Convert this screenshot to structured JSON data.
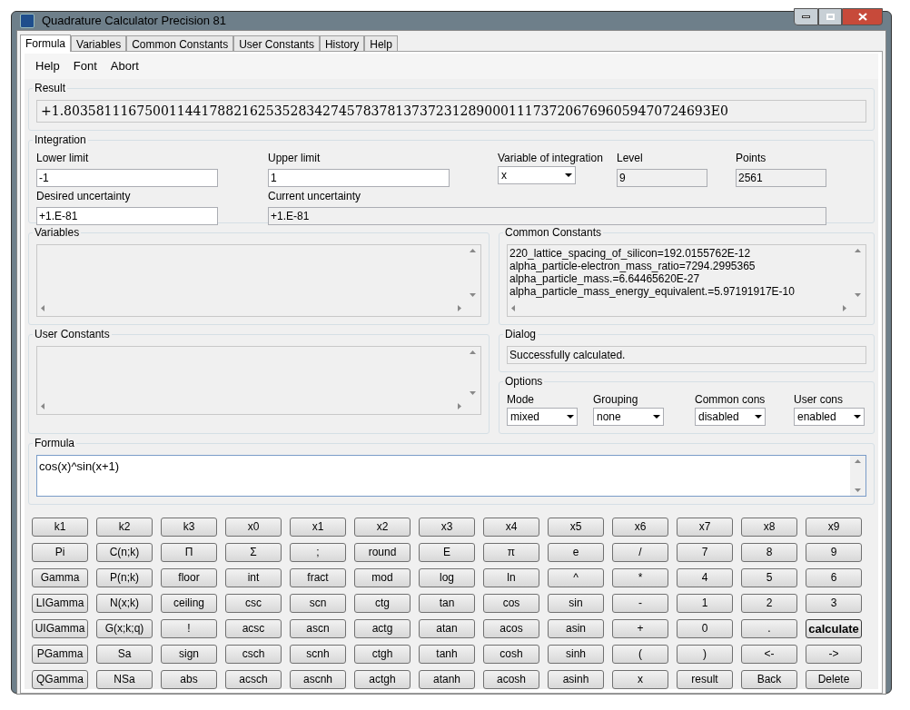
{
  "window": {
    "title": "Quadrature Calculator Precision 81"
  },
  "tabs": [
    {
      "label": "Formula",
      "selected": true
    },
    {
      "label": "Variables",
      "selected": false
    },
    {
      "label": "Common Constants",
      "selected": false
    },
    {
      "label": "User Constants",
      "selected": false
    },
    {
      "label": "History",
      "selected": false
    },
    {
      "label": "Help",
      "selected": false
    }
  ],
  "menu": [
    "Help",
    "Font",
    "Abort"
  ],
  "result": {
    "label": "Result",
    "value": "+1.80358111675001144178821625352834274578378137372312890001117372067696059470724693E0"
  },
  "integration": {
    "label": "Integration",
    "lower_limit": {
      "label": "Lower limit",
      "value": "-1"
    },
    "upper_limit": {
      "label": "Upper limit",
      "value": "1"
    },
    "variable": {
      "label": "Variable of integration",
      "value": "x"
    },
    "level": {
      "label": "Level",
      "value": "9"
    },
    "points": {
      "label": "Points",
      "value": "2561"
    },
    "desired_uncertainty": {
      "label": "Desired uncertainty",
      "value": "+1.E-81"
    },
    "current_uncertainty": {
      "label": "Current uncertainty",
      "value": "+1.E-81"
    }
  },
  "variables": {
    "label": "Variables"
  },
  "common_constants": {
    "label": "Common Constants",
    "items": [
      "220_lattice_spacing_of_silicon=192.0155762E-12",
      "alpha_particle-electron_mass_ratio=7294.2995365",
      "alpha_particle_mass.=6.64465620E-27",
      "alpha_particle_mass_energy_equivalent.=5.97191917E-10"
    ]
  },
  "user_constants": {
    "label": "User Constants"
  },
  "dialog": {
    "label": "Dialog",
    "message": "Successfully calculated."
  },
  "options": {
    "label": "Options",
    "fields": [
      {
        "label": "Mode",
        "value": "mixed"
      },
      {
        "label": "Grouping",
        "value": "none"
      },
      {
        "label": "Common cons",
        "value": "disabled"
      },
      {
        "label": "User cons",
        "value": "enabled"
      }
    ]
  },
  "formula": {
    "label": "Formula",
    "value": "cos(x)^sin(x+1)"
  },
  "keypad": {
    "rows": [
      [
        {
          "label": "k1",
          "default": false
        },
        {
          "label": "k2",
          "default": false
        },
        {
          "label": "k3",
          "default": false
        },
        {
          "label": "x0",
          "default": false
        },
        {
          "label": "x1",
          "default": false
        },
        {
          "label": "x2",
          "default": false
        },
        {
          "label": "x3",
          "default": false
        },
        {
          "label": "x4",
          "default": false
        },
        {
          "label": "x5",
          "default": false
        },
        {
          "label": "x6",
          "default": false
        },
        {
          "label": "x7",
          "default": false
        },
        {
          "label": "x8",
          "default": false
        },
        {
          "label": "x9",
          "default": false
        }
      ],
      [
        {
          "label": "Pi",
          "default": false
        },
        {
          "label": "C(n;k)",
          "default": false
        },
        {
          "label": "Π",
          "default": false
        },
        {
          "label": "Σ",
          "default": false
        },
        {
          "label": ";",
          "default": false
        },
        {
          "label": "round",
          "default": false
        },
        {
          "label": "E",
          "default": false
        },
        {
          "label": "π",
          "default": false
        },
        {
          "label": "e",
          "default": false
        },
        {
          "label": "/",
          "default": false
        },
        {
          "label": "7",
          "default": false
        },
        {
          "label": "8",
          "default": false
        },
        {
          "label": "9",
          "default": false
        }
      ],
      [
        {
          "label": "Gamma",
          "default": false
        },
        {
          "label": "P(n;k)",
          "default": false
        },
        {
          "label": "floor",
          "default": false
        },
        {
          "label": "int",
          "default": false
        },
        {
          "label": "fract",
          "default": false
        },
        {
          "label": "mod",
          "default": false
        },
        {
          "label": "log",
          "default": false
        },
        {
          "label": "ln",
          "default": false
        },
        {
          "label": "^",
          "default": false
        },
        {
          "label": "*",
          "default": false
        },
        {
          "label": "4",
          "default": false
        },
        {
          "label": "5",
          "default": false
        },
        {
          "label": "6",
          "default": false
        }
      ],
      [
        {
          "label": "LIGamma",
          "default": false
        },
        {
          "label": "N(x;k)",
          "default": false
        },
        {
          "label": "ceiling",
          "default": false
        },
        {
          "label": "csc",
          "default": false
        },
        {
          "label": "scn",
          "default": false
        },
        {
          "label": "ctg",
          "default": false
        },
        {
          "label": "tan",
          "default": false
        },
        {
          "label": "cos",
          "default": false
        },
        {
          "label": "sin",
          "default": false
        },
        {
          "label": "-",
          "default": false
        },
        {
          "label": "1",
          "default": false
        },
        {
          "label": "2",
          "default": false
        },
        {
          "label": "3",
          "default": false
        }
      ],
      [
        {
          "label": "UIGamma",
          "default": false
        },
        {
          "label": "G(x;k;q)",
          "default": false
        },
        {
          "label": "!",
          "default": false
        },
        {
          "label": "acsc",
          "default": false
        },
        {
          "label": "ascn",
          "default": false
        },
        {
          "label": "actg",
          "default": false
        },
        {
          "label": "atan",
          "default": false
        },
        {
          "label": "acos",
          "default": false
        },
        {
          "label": "asin",
          "default": false
        },
        {
          "label": "+",
          "default": false
        },
        {
          "label": "0",
          "default": false
        },
        {
          "label": ".",
          "default": false
        },
        {
          "label": "calculate",
          "default": true
        }
      ],
      [
        {
          "label": "PGamma",
          "default": false
        },
        {
          "label": "Sa",
          "default": false
        },
        {
          "label": "sign",
          "default": false
        },
        {
          "label": "csch",
          "default": false
        },
        {
          "label": "scnh",
          "default": false
        },
        {
          "label": "ctgh",
          "default": false
        },
        {
          "label": "tanh",
          "default": false
        },
        {
          "label": "cosh",
          "default": false
        },
        {
          "label": "sinh",
          "default": false
        },
        {
          "label": "(",
          "default": false
        },
        {
          "label": ")",
          "default": false
        },
        {
          "label": "<-",
          "default": false
        },
        {
          "label": "->",
          "default": false
        }
      ],
      [
        {
          "label": "QGamma",
          "default": false
        },
        {
          "label": "NSa",
          "default": false
        },
        {
          "label": "abs",
          "default": false
        },
        {
          "label": "acsch",
          "default": false
        },
        {
          "label": "ascnh",
          "default": false
        },
        {
          "label": "actgh",
          "default": false
        },
        {
          "label": "atanh",
          "default": false
        },
        {
          "label": "acosh",
          "default": false
        },
        {
          "label": "asinh",
          "default": false
        },
        {
          "label": "x",
          "default": false
        },
        {
          "label": "result",
          "default": false
        },
        {
          "label": "Back",
          "default": false
        },
        {
          "label": "Delete",
          "default": false
        }
      ]
    ]
  }
}
